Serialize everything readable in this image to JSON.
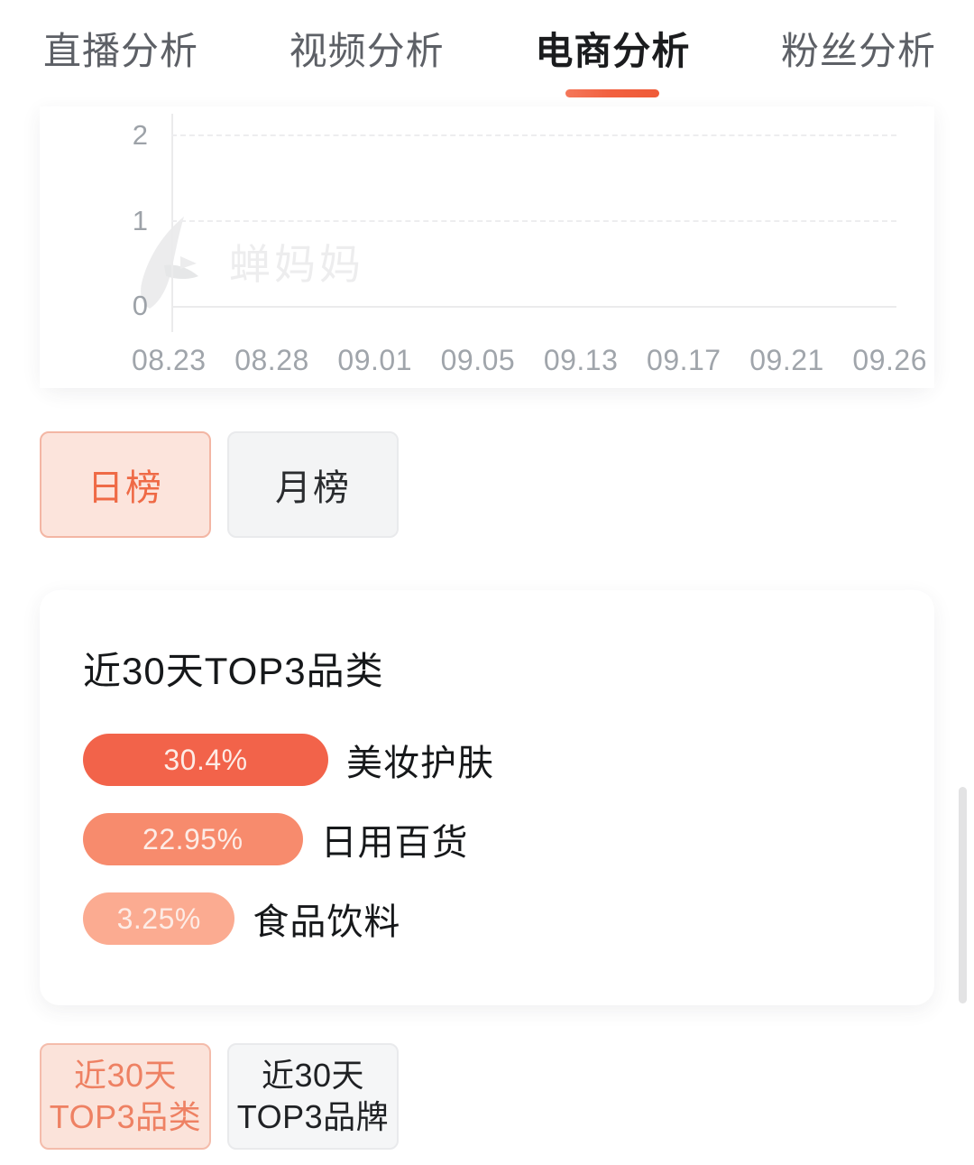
{
  "tabs": [
    {
      "label": "直播分析",
      "active": false
    },
    {
      "label": "视频分析",
      "active": false
    },
    {
      "label": "电商分析",
      "active": true
    },
    {
      "label": "粉丝分析",
      "active": false
    }
  ],
  "chart_data": {
    "type": "line",
    "title": "",
    "xlabel": "",
    "ylabel": "",
    "x": [
      "08.23",
      "08.28",
      "09.01",
      "09.05",
      "09.13",
      "09.17",
      "09.21",
      "09.26"
    ],
    "yticks": [
      "0",
      "1",
      "2"
    ],
    "ylim": [
      0,
      2
    ],
    "values": [
      0,
      0,
      0,
      0,
      0,
      0,
      0,
      0
    ],
    "grid": true,
    "legend": "none",
    "watermark": "蝉妈妈"
  },
  "rank_toggle": {
    "options": [
      {
        "label": "日榜",
        "active": true
      },
      {
        "label": "月榜",
        "active": false
      }
    ]
  },
  "top3_card": {
    "title": "近30天TOP3品类",
    "items": [
      {
        "percent": "30.4%",
        "value": 30.4,
        "name": "美妆护肤",
        "color": "#f2634a"
      },
      {
        "percent": "22.95%",
        "value": 22.95,
        "name": "日用百货",
        "color": "#f78b6d"
      },
      {
        "percent": "3.25%",
        "value": 3.25,
        "name": "食品饮料",
        "color": "#fbab91"
      }
    ]
  },
  "bottom_chips": [
    {
      "line1": "近30天",
      "line2": "TOP3品类",
      "active": true
    },
    {
      "line1": "近30天",
      "line2": "TOP3品牌",
      "active": false
    }
  ]
}
